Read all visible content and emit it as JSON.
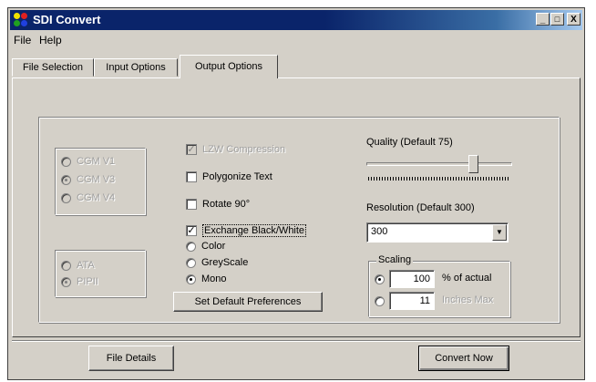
{
  "window": {
    "title": "SDI Convert",
    "buttons": {
      "minimize": "_",
      "maximize": "□",
      "close": "X"
    }
  },
  "menu": [
    "File",
    "Help"
  ],
  "tabs": [
    "File Selection",
    "Input Options",
    "Output Options"
  ],
  "active_tab": "Output Options",
  "cgm_versions": [
    {
      "label": "CGM V1",
      "selected": false,
      "enabled": false
    },
    {
      "label": "CGM V3",
      "selected": true,
      "enabled": false
    },
    {
      "label": "CGM V4",
      "selected": false,
      "enabled": false
    }
  ],
  "formats": [
    {
      "label": "ATA",
      "selected": false,
      "enabled": false
    },
    {
      "label": "PIPII",
      "selected": true,
      "enabled": false
    }
  ],
  "options": {
    "lzw": {
      "label": "LZW Compression",
      "checked": true,
      "enabled": false
    },
    "polygonize": {
      "label": "Polygonize Text",
      "checked": false
    },
    "rotate": {
      "label": "Rotate 90°",
      "checked": false
    },
    "exchange": {
      "label": "Exchange Black/White",
      "checked": true
    }
  },
  "color_modes": [
    {
      "label": "Color",
      "selected": false
    },
    {
      "label": "GreyScale",
      "selected": false
    },
    {
      "label": "Mono",
      "selected": true
    }
  ],
  "set_default_label": "Set Default Preferences",
  "quality": {
    "label": "Quality (Default 75)",
    "value": 75
  },
  "resolution": {
    "label": "Resolution (Default 300)",
    "value": "300"
  },
  "scaling": {
    "label": "Scaling",
    "percent": {
      "value": "100",
      "label": "% of actual",
      "selected": true
    },
    "inches": {
      "value": "11",
      "label": "Inches Max",
      "selected": false
    }
  },
  "bottom": {
    "file_details": "File Details",
    "convert_now": "Convert Now"
  },
  "colors": {
    "title_bar": "#0a246a",
    "face": "#d4d0c8"
  }
}
